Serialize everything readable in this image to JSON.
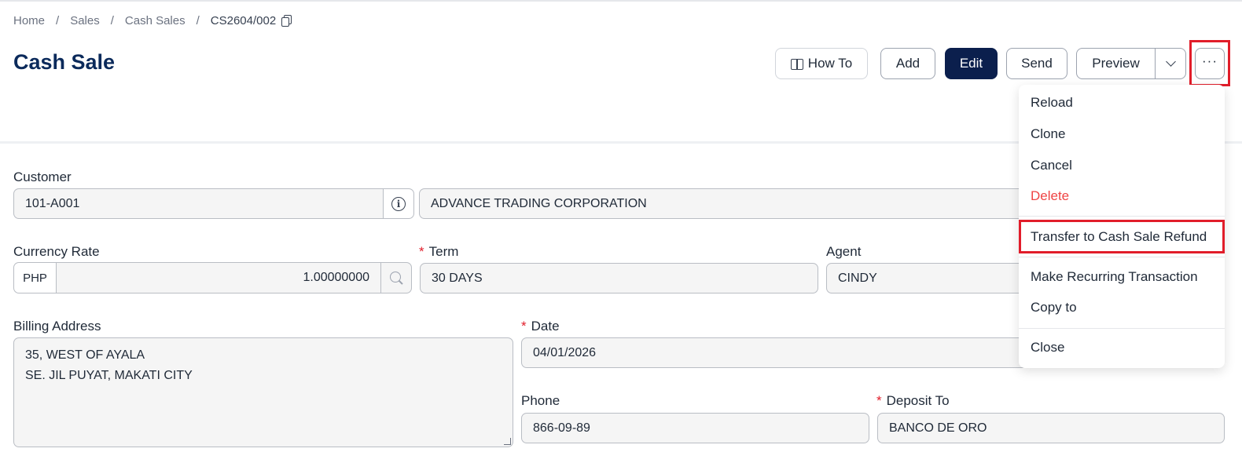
{
  "breadcrumb": {
    "items": [
      "Home",
      "Sales",
      "Cash Sales"
    ],
    "separator": "/",
    "current": "CS2604/002"
  },
  "page": {
    "title": "Cash Sale"
  },
  "toolbar": {
    "howto_label": "How To",
    "add_label": "Add",
    "edit_label": "Edit",
    "send_label": "Send",
    "preview_label": "Preview",
    "more_label": "···"
  },
  "menu": {
    "items": [
      {
        "label": "Reload"
      },
      {
        "label": "Clone"
      },
      {
        "label": "Cancel"
      },
      {
        "label": "Delete",
        "color": "#ef4444"
      },
      {
        "label": "Transfer to Cash Sale Refund",
        "highlighted": true
      },
      {
        "label": "Make Recurring Transaction"
      },
      {
        "label": "Copy to"
      },
      {
        "label": "Close"
      }
    ]
  },
  "form": {
    "customer": {
      "label": "Customer",
      "code": "101-A001",
      "name": "ADVANCE TRADING CORPORATION"
    },
    "currency_rate": {
      "label": "Currency Rate",
      "currency": "PHP",
      "value": "1.00000000"
    },
    "term": {
      "label": "Term",
      "required_mark": "*",
      "value": "30 DAYS"
    },
    "agent": {
      "label": "Agent",
      "value": "CINDY"
    },
    "billing_address": {
      "label": "Billing Address",
      "line1": "35, WEST OF AYALA",
      "line2": "SE. JIL PUYAT, MAKATI CITY"
    },
    "date": {
      "label": "Date",
      "required_mark": "*",
      "value": "04/01/2026"
    },
    "phone": {
      "label": "Phone",
      "value": "866-09-89"
    },
    "deposit_to": {
      "label": "Deposit To",
      "required_mark": "*",
      "value": "BANCO DE ORO"
    }
  },
  "colors": {
    "brand_navy": "#0b2a5b",
    "edit_button": "#0b1f4d",
    "highlight_red": "#e11d2a",
    "delete_red": "#ef4444"
  }
}
